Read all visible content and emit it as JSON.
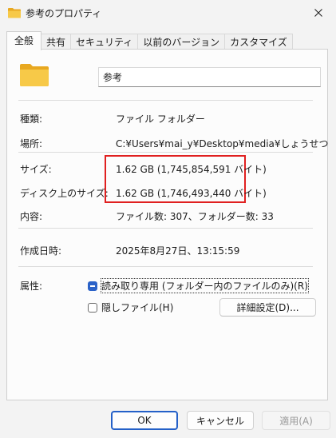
{
  "window": {
    "title": "参考のプロパティ",
    "close_icon": "close-icon"
  },
  "tabs": [
    {
      "label": "全般",
      "active": true
    },
    {
      "label": "共有",
      "active": false
    },
    {
      "label": "セキュリティ",
      "active": false
    },
    {
      "label": "以前のバージョン",
      "active": false
    },
    {
      "label": "カスタマイズ",
      "active": false
    }
  ],
  "general": {
    "folder_name": "参考",
    "type_label": "種類:",
    "type_value": "ファイル フォルダー",
    "location_label": "場所:",
    "location_value": "C:¥Users¥mai_y¥Desktop¥media¥しょうせつ",
    "size_label": "サイズ:",
    "size_value": "1.62 GB (1,745,854,591 バイト)",
    "disk_size_label": "ディスク上のサイズ:",
    "disk_size_value": "1.62 GB (1,746,493,440 バイト)",
    "contents_label": "内容:",
    "contents_value": "ファイル数: 307、フォルダー数: 33",
    "created_label": "作成日時:",
    "created_value": "2025年8月27日、13:15:59",
    "attributes_label": "属性:",
    "readonly_label": "読み取り専用 (フォルダー内のファイルのみ)(R)",
    "readonly_state": "indeterminate",
    "hidden_label": "隠しファイル(H)",
    "hidden_state": "unchecked",
    "advanced_button": "詳細設定(D)..."
  },
  "footer": {
    "ok": "OK",
    "cancel": "キャンセル",
    "apply": "適用(A)"
  },
  "colors": {
    "highlight_box": "#e02020",
    "accent": "#2b62c8",
    "folder": "#f7c948"
  }
}
